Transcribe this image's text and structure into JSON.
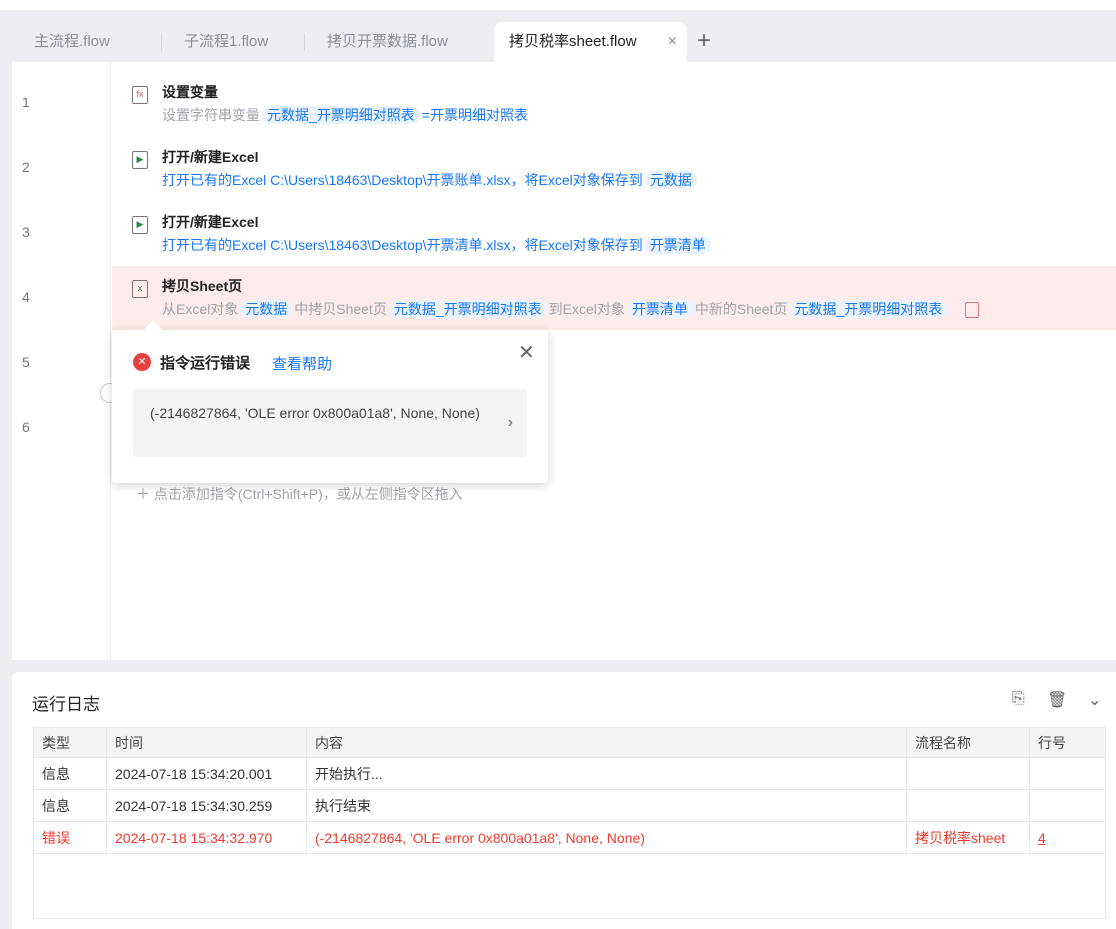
{
  "tabs": [
    {
      "label": "主流程.flow"
    },
    {
      "label": "子流程1.flow"
    },
    {
      "label": "拷贝开票数据.flow"
    },
    {
      "label": "拷贝税率sheet.flow",
      "close": "×"
    }
  ],
  "add_tab": "+",
  "steps": [
    {
      "line": "1",
      "title": "设置变量",
      "desc_prefix": "设置字符串变量",
      "chip1": "元数据_开票明细对照表",
      "desc_suffix": "=开票明细对照表"
    },
    {
      "line": "2",
      "title": "打开/新建Excel",
      "desc": "打开已有的Excel C:\\Users\\18463\\Desktop\\开票账单.xlsx，将Excel对象保存到",
      "chip1": "元数据"
    },
    {
      "line": "3",
      "title": "打开/新建Excel",
      "desc": "打开已有的Excel C:\\Users\\18463\\Desktop\\开票清单.xlsx，将Excel对象保存到",
      "chip1": "开票清单"
    },
    {
      "line": "4",
      "title": "拷贝Sheet页",
      "p1": "从Excel对象",
      "chip1": "元数据",
      "p2": "中拷贝Sheet页",
      "chip2": "元数据_开票明细对照表",
      "p3": "到Excel对象",
      "chip3": "开票清单",
      "p4": "中新的Sheet页",
      "chip4": "元数据_开票明细对照表"
    }
  ],
  "extra_lines": [
    "5",
    "6"
  ],
  "popup": {
    "title": "指令运行错误",
    "help": "查看帮助",
    "message": "(-2146827864, 'OLE error 0x800a01a8', None, None)"
  },
  "add_instruction": "点击添加指令(Ctrl+Shift+P)，或从左侧指令区拖入",
  "log": {
    "title": "运行日志",
    "columns": [
      "类型",
      "时间",
      "内容",
      "流程名称",
      "行号"
    ],
    "rows": [
      [
        "信息",
        "2024-07-18 15:34:20.001",
        "开始执行...",
        "",
        ""
      ],
      [
        "信息",
        "2024-07-18 15:34:30.259",
        "执行结束",
        "",
        ""
      ],
      [
        "错误",
        "2024-07-18 15:34:32.970",
        "(-2146827864, 'OLE error 0x800a01a8', None, None)",
        "拷贝税率sheet",
        "4"
      ]
    ]
  }
}
